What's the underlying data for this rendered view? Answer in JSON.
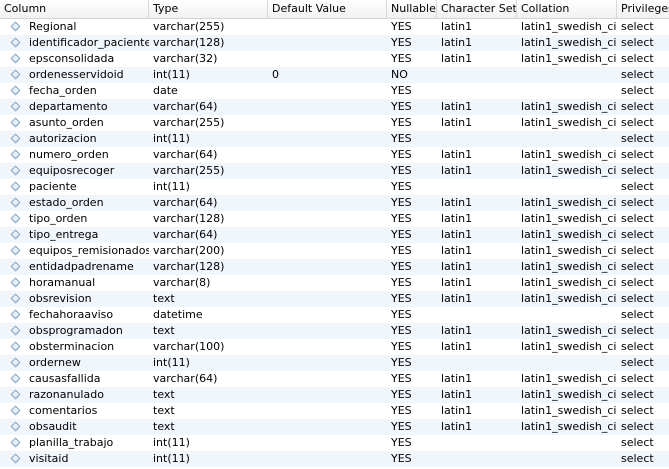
{
  "columns": {
    "column": "Column",
    "type": "Type",
    "default": "Default Value",
    "nullable": "Nullable",
    "charset": "Character Set",
    "collation": "Collation",
    "privileges": "Privileges"
  },
  "rows": [
    {
      "name": "Regional",
      "type": "varchar(255)",
      "default": "",
      "nullable": "YES",
      "charset": "latin1",
      "collation": "latin1_swedish_ci",
      "privileges": "select"
    },
    {
      "name": "identificador_paciente",
      "type": "varchar(128)",
      "default": "",
      "nullable": "YES",
      "charset": "latin1",
      "collation": "latin1_swedish_ci",
      "privileges": "select"
    },
    {
      "name": "epsconsolidada",
      "type": "varchar(32)",
      "default": "",
      "nullable": "YES",
      "charset": "latin1",
      "collation": "latin1_swedish_ci",
      "privileges": "select"
    },
    {
      "name": "ordenesservidoid",
      "type": "int(11)",
      "default": "0",
      "nullable": "NO",
      "charset": "",
      "collation": "",
      "privileges": "select"
    },
    {
      "name": "fecha_orden",
      "type": "date",
      "default": "",
      "nullable": "YES",
      "charset": "",
      "collation": "",
      "privileges": "select"
    },
    {
      "name": "departamento",
      "type": "varchar(64)",
      "default": "",
      "nullable": "YES",
      "charset": "latin1",
      "collation": "latin1_swedish_ci",
      "privileges": "select"
    },
    {
      "name": "asunto_orden",
      "type": "varchar(255)",
      "default": "",
      "nullable": "YES",
      "charset": "latin1",
      "collation": "latin1_swedish_ci",
      "privileges": "select"
    },
    {
      "name": "autorizacion",
      "type": "int(11)",
      "default": "",
      "nullable": "YES",
      "charset": "",
      "collation": "",
      "privileges": "select"
    },
    {
      "name": "numero_orden",
      "type": "varchar(64)",
      "default": "",
      "nullable": "YES",
      "charset": "latin1",
      "collation": "latin1_swedish_ci",
      "privileges": "select"
    },
    {
      "name": "equiposrecoger",
      "type": "varchar(255)",
      "default": "",
      "nullable": "YES",
      "charset": "latin1",
      "collation": "latin1_swedish_ci",
      "privileges": "select"
    },
    {
      "name": "paciente",
      "type": "int(11)",
      "default": "",
      "nullable": "YES",
      "charset": "",
      "collation": "",
      "privileges": "select"
    },
    {
      "name": "estado_orden",
      "type": "varchar(64)",
      "default": "",
      "nullable": "YES",
      "charset": "latin1",
      "collation": "latin1_swedish_ci",
      "privileges": "select"
    },
    {
      "name": "tipo_orden",
      "type": "varchar(128)",
      "default": "",
      "nullable": "YES",
      "charset": "latin1",
      "collation": "latin1_swedish_ci",
      "privileges": "select"
    },
    {
      "name": "tipo_entrega",
      "type": "varchar(64)",
      "default": "",
      "nullable": "YES",
      "charset": "latin1",
      "collation": "latin1_swedish_ci",
      "privileges": "select"
    },
    {
      "name": "equipos_remisionados",
      "type": "varchar(200)",
      "default": "",
      "nullable": "YES",
      "charset": "latin1",
      "collation": "latin1_swedish_ci",
      "privileges": "select"
    },
    {
      "name": "entidadpadrename",
      "type": "varchar(128)",
      "default": "",
      "nullable": "YES",
      "charset": "latin1",
      "collation": "latin1_swedish_ci",
      "privileges": "select"
    },
    {
      "name": "horamanual",
      "type": "varchar(8)",
      "default": "",
      "nullable": "YES",
      "charset": "latin1",
      "collation": "latin1_swedish_ci",
      "privileges": "select"
    },
    {
      "name": "obsrevision",
      "type": "text",
      "default": "",
      "nullable": "YES",
      "charset": "latin1",
      "collation": "latin1_swedish_ci",
      "privileges": "select"
    },
    {
      "name": "fechahoraaviso",
      "type": "datetime",
      "default": "",
      "nullable": "YES",
      "charset": "",
      "collation": "",
      "privileges": "select"
    },
    {
      "name": "obsprogramadon",
      "type": "text",
      "default": "",
      "nullable": "YES",
      "charset": "latin1",
      "collation": "latin1_swedish_ci",
      "privileges": "select"
    },
    {
      "name": "obsterminacion",
      "type": "varchar(100)",
      "default": "",
      "nullable": "YES",
      "charset": "latin1",
      "collation": "latin1_swedish_ci",
      "privileges": "select"
    },
    {
      "name": "ordernew",
      "type": "int(11)",
      "default": "",
      "nullable": "YES",
      "charset": "",
      "collation": "",
      "privileges": "select"
    },
    {
      "name": "causasfallida",
      "type": "varchar(64)",
      "default": "",
      "nullable": "YES",
      "charset": "latin1",
      "collation": "latin1_swedish_ci",
      "privileges": "select"
    },
    {
      "name": "razonanulado",
      "type": "text",
      "default": "",
      "nullable": "YES",
      "charset": "latin1",
      "collation": "latin1_swedish_ci",
      "privileges": "select"
    },
    {
      "name": "comentarios",
      "type": "text",
      "default": "",
      "nullable": "YES",
      "charset": "latin1",
      "collation": "latin1_swedish_ci",
      "privileges": "select"
    },
    {
      "name": "obsaudit",
      "type": "text",
      "default": "",
      "nullable": "YES",
      "charset": "latin1",
      "collation": "latin1_swedish_ci",
      "privileges": "select"
    },
    {
      "name": "planilla_trabajo",
      "type": "int(11)",
      "default": "",
      "nullable": "YES",
      "charset": "",
      "collation": "",
      "privileges": "select"
    },
    {
      "name": "visitaid",
      "type": "int(11)",
      "default": "",
      "nullable": "YES",
      "charset": "",
      "collation": "",
      "privileges": "select"
    }
  ]
}
